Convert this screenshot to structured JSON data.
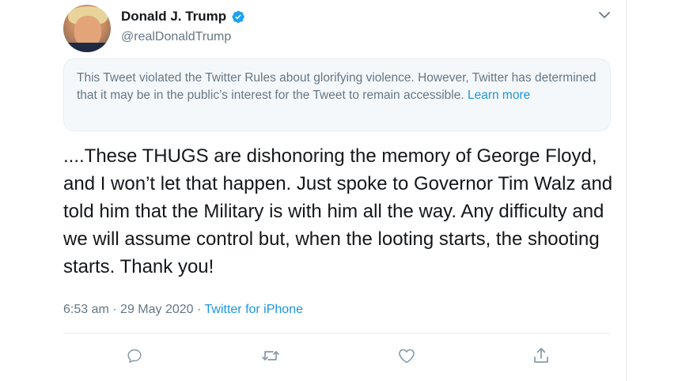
{
  "tweet": {
    "author": {
      "display_name": "Donald J. Trump",
      "handle": "@realDonaldTrump",
      "verified": true
    },
    "notice": {
      "text": "This Tweet violated the Twitter Rules about glorifying violence. However, Twitter has determined that it may be in the public’s interest for the Tweet to remain accessible.",
      "link_text": "Learn more"
    },
    "text": "....These THUGS are dishonoring the memory of George Floyd, and I won’t let that happen. Just spoke to Governor Tim Walz and told him that the Military is with him all the way. Any difficulty and we will assume control but, when the looting starts, the shooting starts. Thank you!",
    "time": "6:53 am",
    "date": "29 May 2020",
    "separator": "·",
    "source": "Twitter for iPhone"
  },
  "icons": {
    "verified": "verified-badge-icon",
    "more": "chevron-down-icon",
    "reply": "reply-icon",
    "retweet": "retweet-icon",
    "like": "like-icon",
    "share": "share-icon"
  },
  "colors": {
    "link": "#1b95e0",
    "secondary_text": "#657786",
    "primary_text": "#14171a",
    "notice_bg": "#f5f8fa"
  }
}
